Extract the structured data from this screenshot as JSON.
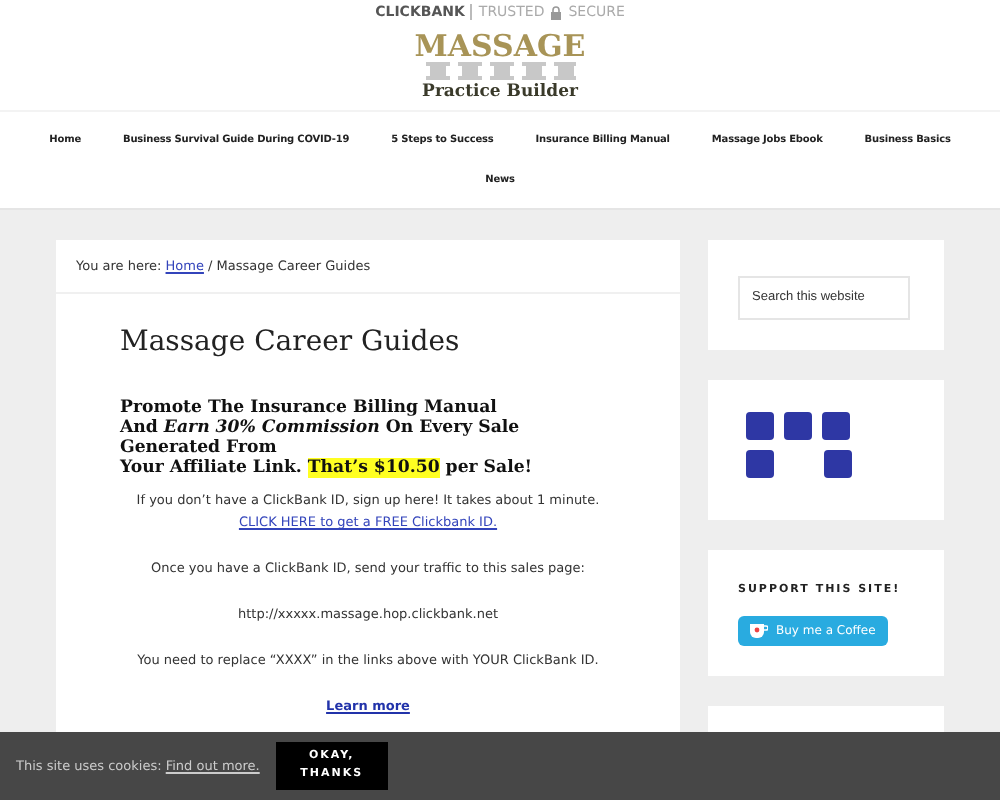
{
  "topbar": {
    "brand": "CLICKBANK",
    "trust": "TRUSTED",
    "secure": "SECURE"
  },
  "logo": {
    "title": "MASSAGE",
    "subtitle": "Practice Builder"
  },
  "nav": [
    "Home",
    "Business Survival Guide During COVID-19",
    "5 Steps to Success",
    "Insurance Billing Manual",
    "Massage Jobs Ebook",
    "Business Basics",
    "News"
  ],
  "breadcrumb": {
    "prefix": "You are here:",
    "link": "Home",
    "current": "/ Massage Career Guides"
  },
  "page_title": "Massage Career Guides",
  "promo": {
    "line_1": "Promote The Insurance Billing Manual",
    "line_2": "And *Earn 30% Commission* On Every Sale Generated From",
    "line_3": "Your Affiliate Link.",
    "highlight": "That’s $10.50",
    "line_3_end": "per Sale!"
  },
  "signup": {
    "text": "If you don’t have a ClickBank ID, sign up here! It takes about 1 minute.",
    "link": "CLICK HERE to get a FREE Clickbank ID."
  },
  "paragraphs": [
    "Once you have a ClickBank ID, send your traffic to this sales page:",
    "http://xxxxx.massage.hop.clickbank.net",
    "You need to replace “XXXX” in the links above with YOUR ClickBank ID."
  ],
  "learn_more": "Learn more",
  "sidebar": {
    "search": {
      "placeholder": "Search this website"
    },
    "support_title": "SUPPORT THIS SITE!",
    "coffee_button": "Buy me a Coffee"
  },
  "cookie_bar": {
    "text": "This site uses cookies:",
    "link": "Find out more.",
    "button": "OKAY, THANKS"
  }
}
